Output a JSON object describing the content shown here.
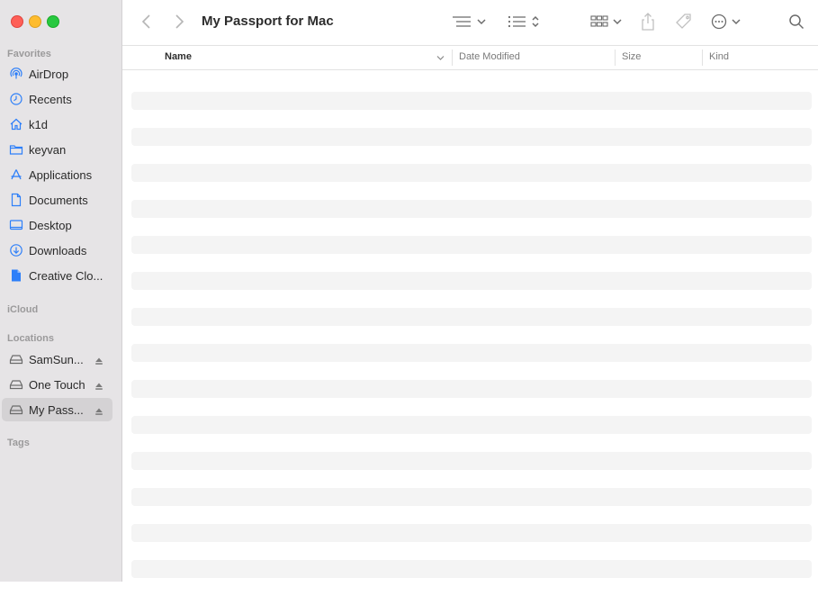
{
  "window": {
    "title": "My Passport for Mac"
  },
  "sidebar": {
    "favorites_label": "Favorites",
    "favorites": [
      {
        "label": "AirDrop",
        "icon": "airdrop-icon"
      },
      {
        "label": "Recents",
        "icon": "clock-icon"
      },
      {
        "label": "k1d",
        "icon": "house-icon"
      },
      {
        "label": "keyvan",
        "icon": "folder-icon"
      },
      {
        "label": "Applications",
        "icon": "applications-icon"
      },
      {
        "label": "Documents",
        "icon": "document-icon"
      },
      {
        "label": "Desktop",
        "icon": "desktop-icon"
      },
      {
        "label": "Downloads",
        "icon": "download-icon"
      },
      {
        "label": "Creative Clo...",
        "icon": "file-icon"
      }
    ],
    "icloud_label": "iCloud",
    "locations_label": "Locations",
    "locations": [
      {
        "label": "SamSun...",
        "icon": "drive-icon"
      },
      {
        "label": "One Touch",
        "icon": "drive-icon"
      },
      {
        "label": "My Pass...",
        "icon": "drive-icon",
        "selected": true
      }
    ],
    "tags_label": "Tags"
  },
  "columns": {
    "name": "Name",
    "date_modified": "Date Modified",
    "size": "Size",
    "kind": "Kind"
  },
  "colors": {
    "sidebar_bg": "#e6e4e6",
    "accent": "#2d7ff9",
    "selected_bg": "#d4d2d4"
  }
}
